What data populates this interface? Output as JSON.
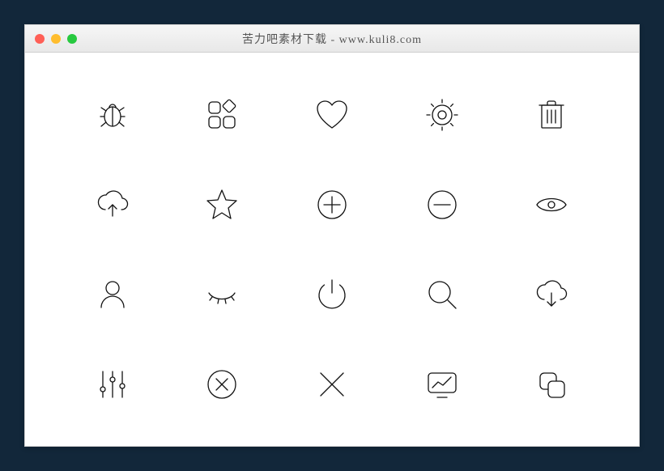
{
  "window": {
    "title": "苦力吧素材下载 - www.kuli8.com"
  },
  "traffic_lights": {
    "close": "#ff5f56",
    "minimize": "#ffbd2e",
    "zoom": "#27c93f"
  },
  "icons": [
    [
      "bug",
      "grid-add",
      "heart",
      "gear",
      "trash"
    ],
    [
      "cloud-upload",
      "star",
      "plus-circle",
      "minus-circle",
      "eye-open"
    ],
    [
      "user",
      "eye-closed",
      "power",
      "search",
      "cloud-download"
    ],
    [
      "sliders",
      "x-circle",
      "close-x",
      "monitor-chart",
      "copy"
    ]
  ]
}
